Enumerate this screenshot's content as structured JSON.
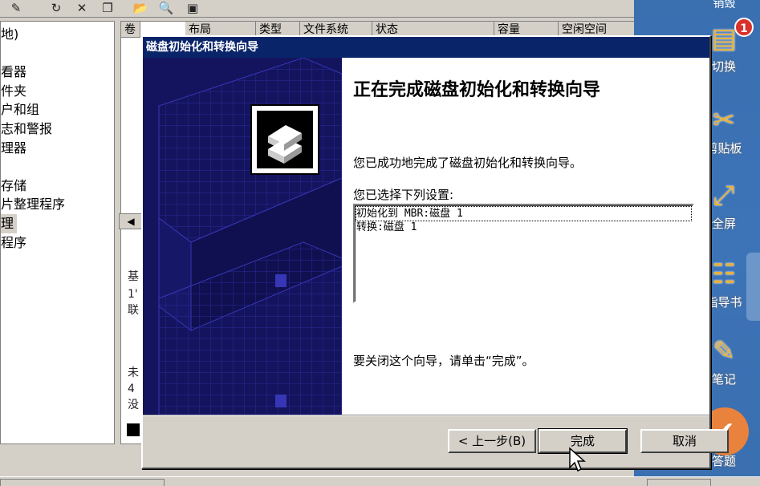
{
  "background_window": {
    "toolbar_icons": [
      "properties-icon",
      "refresh-icon",
      "delete-icon",
      "copy-icon",
      "open-folder-icon",
      "search-icon",
      "disk-icon"
    ],
    "tree_items": [
      "地)",
      "",
      "看器",
      "件夹",
      "户和组",
      "志和警报",
      "理器",
      "",
      "存储",
      "片整理程序",
      "理",
      "程序"
    ],
    "selected_tree_index": 10,
    "columns": [
      "卷",
      "布局",
      "类型",
      "文件系统",
      "状态",
      "容量",
      "空闲空间"
    ],
    "list_fragments": [
      "基",
      "1'",
      "联",
      "未",
      "4",
      "没"
    ]
  },
  "side_toolbar": {
    "top_label": "销毁",
    "badge_count": "1",
    "items": [
      {
        "label": "切换",
        "icon": "switch-icon"
      },
      {
        "label": "剪贴板",
        "icon": "clipboard-icon"
      },
      {
        "label": "全屏",
        "icon": "fullscreen-icon"
      },
      {
        "label": "指导书",
        "icon": "book-icon"
      },
      {
        "label": "笔记",
        "icon": "pen-icon"
      },
      {
        "label": "答题",
        "icon": "answer-icon"
      }
    ]
  },
  "wizard": {
    "title": "磁盘初始化和转换向导",
    "heading": "正在完成磁盘初始化和转换向导",
    "success_text": "您已成功地完成了磁盘初始化和转换向导。",
    "settings_label": "您已选择下列设置:",
    "settings_lines": [
      "初始化到 MBR:磁盘 1",
      "转换:磁盘 1"
    ],
    "close_hint": "要关闭这个向导，请单击“完成”。",
    "buttons": {
      "back": "< 上一步(B)",
      "finish": "完成",
      "cancel": "取消"
    }
  }
}
